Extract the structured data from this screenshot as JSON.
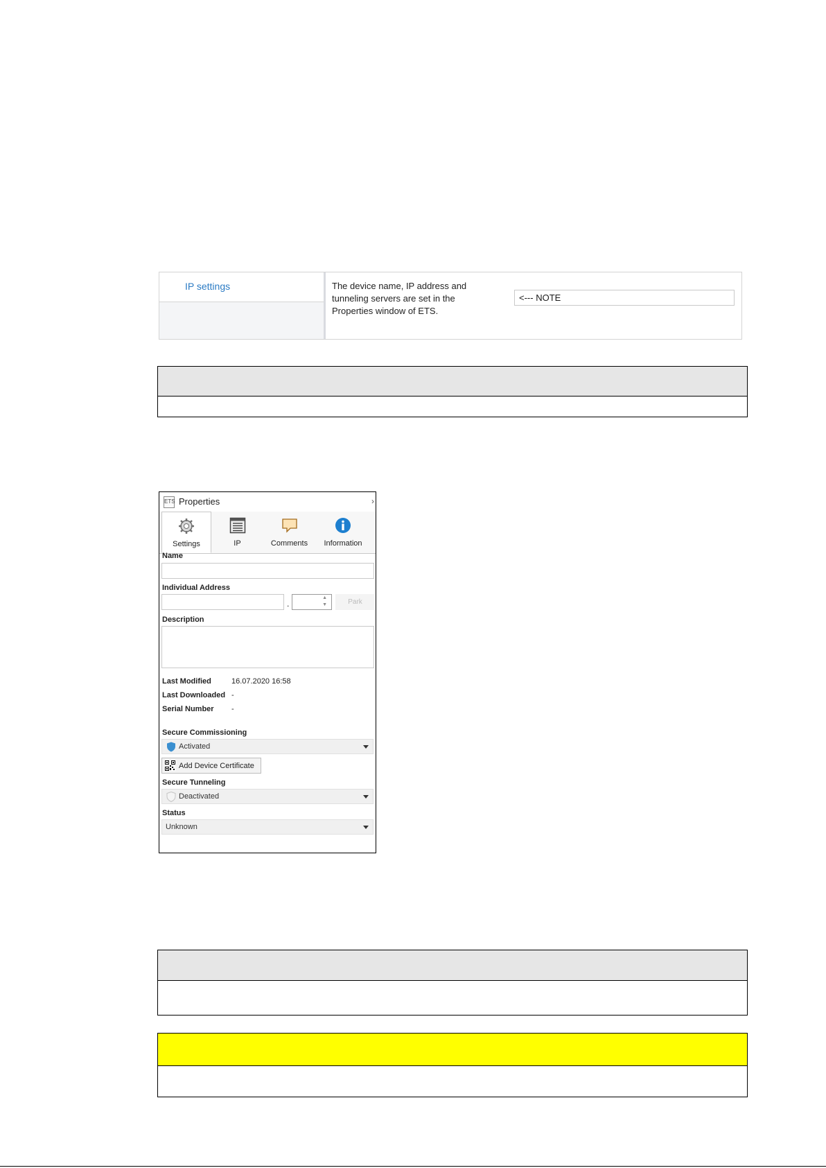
{
  "ip_settings": {
    "nav_label": "IP settings",
    "description": "The device name, IP address and tunneling servers are set in the Properties window of ETS.",
    "note_value": "<--- NOTE"
  },
  "properties": {
    "title": "Properties",
    "tabs": [
      {
        "label": "Settings",
        "icon": "gear-icon"
      },
      {
        "label": "IP",
        "icon": "list-icon"
      },
      {
        "label": "Comments",
        "icon": "comment-icon"
      },
      {
        "label": "Information",
        "icon": "info-icon"
      }
    ],
    "name_label": "Name",
    "individual_address_label": "Individual Address",
    "address_separator": ".",
    "park_label": "Park",
    "description_label": "Description",
    "last_modified_label": "Last Modified",
    "last_modified_value": "16.07.2020 16:58",
    "last_downloaded_label": "Last Downloaded",
    "last_downloaded_value": "-",
    "serial_number_label": "Serial Number",
    "serial_number_value": "-",
    "secure_commissioning_label": "Secure Commissioning",
    "secure_commissioning_value": "Activated",
    "add_certificate_label": "Add Device Certificate",
    "secure_tunneling_label": "Secure Tunneling",
    "secure_tunneling_value": "Deactivated",
    "status_label": "Status",
    "status_value": "Unknown"
  },
  "colors": {
    "link_blue": "#2b7bc4",
    "table_header_grey": "#e6e6e6",
    "warning_yellow": "#ffff00",
    "shield_blue": "#3a8fd0"
  }
}
